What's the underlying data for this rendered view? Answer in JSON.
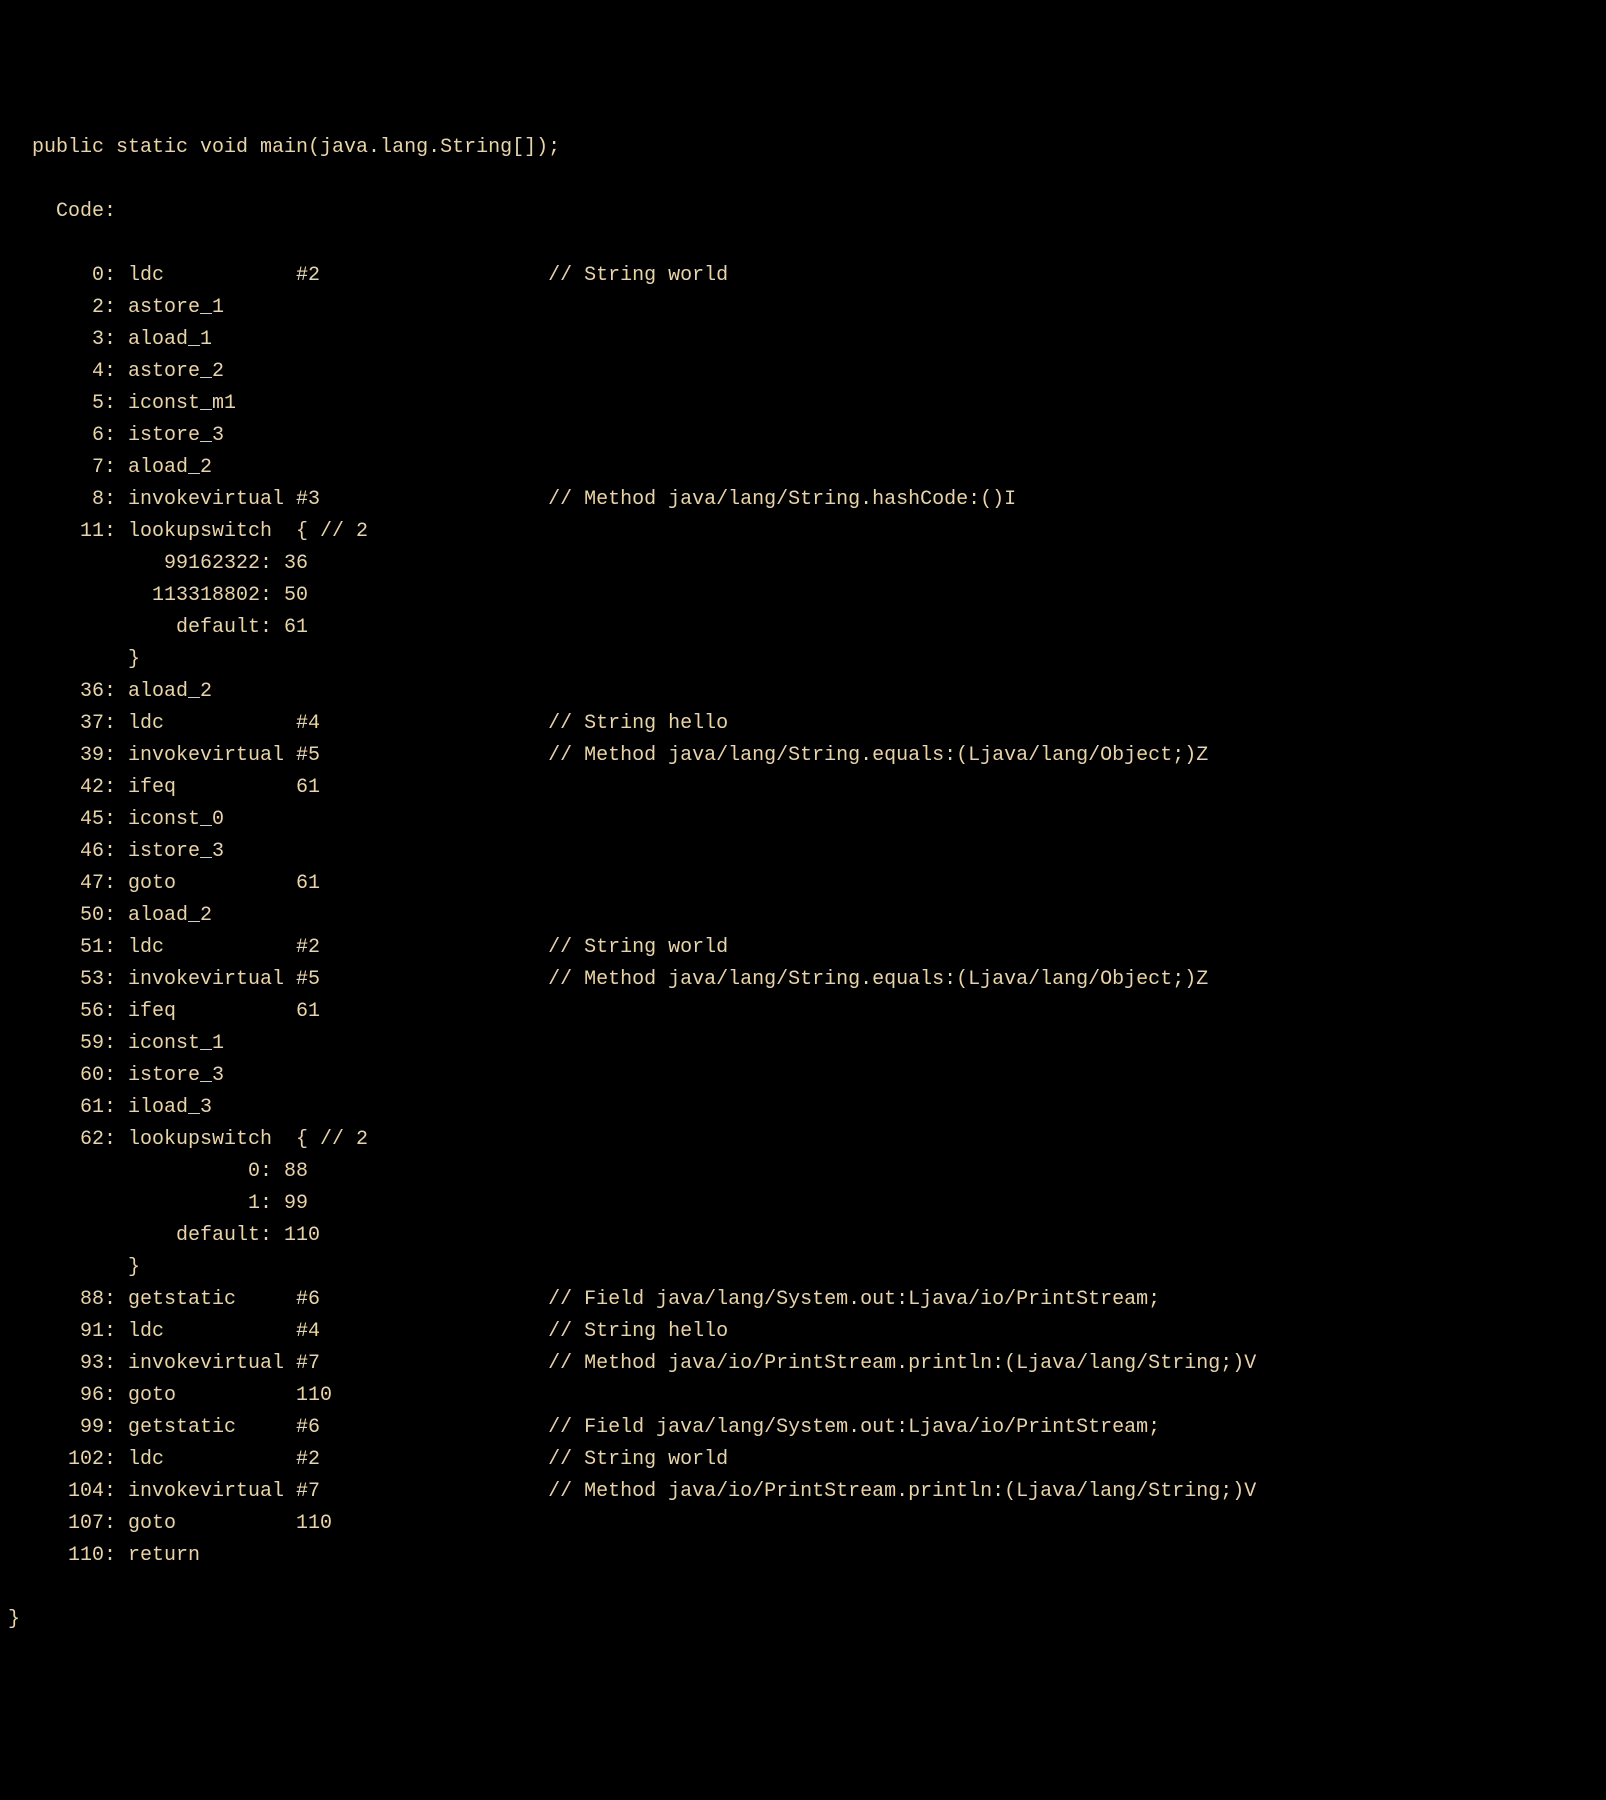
{
  "signature": "  public static void main(java.lang.String[]);",
  "code_label": "    Code:",
  "instructions": [
    {
      "offset": "0",
      "mnemonic": "ldc",
      "arg": "#2",
      "comment": "// String world"
    },
    {
      "offset": "2",
      "mnemonic": "astore_1",
      "arg": "",
      "comment": ""
    },
    {
      "offset": "3",
      "mnemonic": "aload_1",
      "arg": "",
      "comment": ""
    },
    {
      "offset": "4",
      "mnemonic": "astore_2",
      "arg": "",
      "comment": ""
    },
    {
      "offset": "5",
      "mnemonic": "iconst_m1",
      "arg": "",
      "comment": ""
    },
    {
      "offset": "6",
      "mnemonic": "istore_3",
      "arg": "",
      "comment": ""
    },
    {
      "offset": "7",
      "mnemonic": "aload_2",
      "arg": "",
      "comment": ""
    },
    {
      "offset": "8",
      "mnemonic": "invokevirtual",
      "arg": "#3",
      "comment": "// Method java/lang/String.hashCode:()I"
    },
    {
      "offset": "11",
      "mnemonic": "lookupswitch",
      "arg": "",
      "comment": "",
      "raw": "      11: lookupswitch  { // 2"
    },
    {
      "raw": "             99162322: 36"
    },
    {
      "raw": "            113318802: 50"
    },
    {
      "raw": "              default: 61"
    },
    {
      "raw": "          }"
    },
    {
      "offset": "36",
      "mnemonic": "aload_2",
      "arg": "",
      "comment": ""
    },
    {
      "offset": "37",
      "mnemonic": "ldc",
      "arg": "#4",
      "comment": "// String hello"
    },
    {
      "offset": "39",
      "mnemonic": "invokevirtual",
      "arg": "#5",
      "comment": "// Method java/lang/String.equals:(Ljava/lang/Object;)Z"
    },
    {
      "offset": "42",
      "mnemonic": "ifeq",
      "arg": "61",
      "comment": ""
    },
    {
      "offset": "45",
      "mnemonic": "iconst_0",
      "arg": "",
      "comment": ""
    },
    {
      "offset": "46",
      "mnemonic": "istore_3",
      "arg": "",
      "comment": ""
    },
    {
      "offset": "47",
      "mnemonic": "goto",
      "arg": "61",
      "comment": ""
    },
    {
      "offset": "50",
      "mnemonic": "aload_2",
      "arg": "",
      "comment": ""
    },
    {
      "offset": "51",
      "mnemonic": "ldc",
      "arg": "#2",
      "comment": "// String world"
    },
    {
      "offset": "53",
      "mnemonic": "invokevirtual",
      "arg": "#5",
      "comment": "// Method java/lang/String.equals:(Ljava/lang/Object;)Z"
    },
    {
      "offset": "56",
      "mnemonic": "ifeq",
      "arg": "61",
      "comment": ""
    },
    {
      "offset": "59",
      "mnemonic": "iconst_1",
      "arg": "",
      "comment": ""
    },
    {
      "offset": "60",
      "mnemonic": "istore_3",
      "arg": "",
      "comment": ""
    },
    {
      "offset": "61",
      "mnemonic": "iload_3",
      "arg": "",
      "comment": ""
    },
    {
      "offset": "62",
      "mnemonic": "lookupswitch",
      "arg": "",
      "comment": "",
      "raw": "      62: lookupswitch  { // 2"
    },
    {
      "raw": "                    0: 88"
    },
    {
      "raw": "                    1: 99"
    },
    {
      "raw": "              default: 110"
    },
    {
      "raw": "          }"
    },
    {
      "offset": "88",
      "mnemonic": "getstatic",
      "arg": "#6",
      "comment": "// Field java/lang/System.out:Ljava/io/PrintStream;"
    },
    {
      "offset": "91",
      "mnemonic": "ldc",
      "arg": "#4",
      "comment": "// String hello"
    },
    {
      "offset": "93",
      "mnemonic": "invokevirtual",
      "arg": "#7",
      "comment": "// Method java/io/PrintStream.println:(Ljava/lang/String;)V"
    },
    {
      "offset": "96",
      "mnemonic": "goto",
      "arg": "110",
      "comment": ""
    },
    {
      "offset": "99",
      "mnemonic": "getstatic",
      "arg": "#6",
      "comment": "// Field java/lang/System.out:Ljava/io/PrintStream;"
    },
    {
      "offset": "102",
      "mnemonic": "ldc",
      "arg": "#2",
      "comment": "// String world"
    },
    {
      "offset": "104",
      "mnemonic": "invokevirtual",
      "arg": "#7",
      "comment": "// Method java/io/PrintStream.println:(Ljava/lang/String;)V"
    },
    {
      "offset": "107",
      "mnemonic": "goto",
      "arg": "110",
      "comment": ""
    },
    {
      "offset": "110",
      "mnemonic": "return",
      "arg": "",
      "comment": ""
    }
  ],
  "closing_brace": "}"
}
